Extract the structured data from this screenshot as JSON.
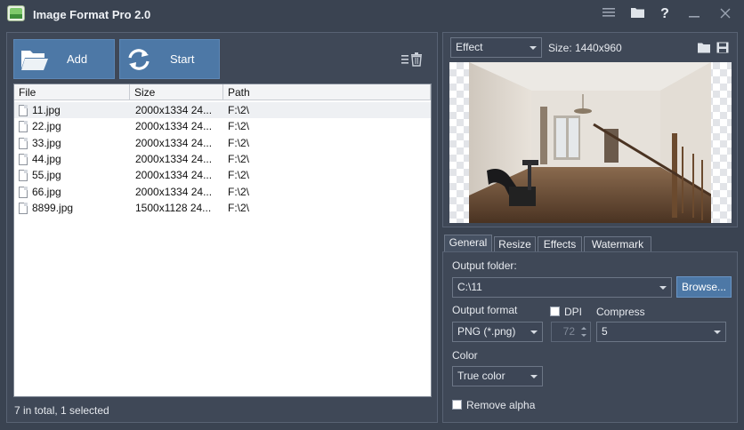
{
  "app": {
    "title": "Image Format Pro 2.0",
    "icons": [
      "menu-icon",
      "folder-icon",
      "help-icon",
      "minimize-icon",
      "close-icon"
    ],
    "help_label": "?"
  },
  "toolbar": {
    "add_label": "Add",
    "start_label": "Start",
    "accent": "#4d78a6"
  },
  "file_list": {
    "columns": [
      "File",
      "Size",
      "Path"
    ],
    "rows": [
      {
        "file": "11.jpg",
        "size": "2000x1334  24...",
        "path": "F:\\2\\",
        "selected": true
      },
      {
        "file": "22.jpg",
        "size": "2000x1334  24...",
        "path": "F:\\2\\"
      },
      {
        "file": "33.jpg",
        "size": "2000x1334  24...",
        "path": "F:\\2\\"
      },
      {
        "file": "44.jpg",
        "size": "2000x1334  24...",
        "path": "F:\\2\\"
      },
      {
        "file": "55.jpg",
        "size": "2000x1334  24...",
        "path": "F:\\2\\"
      },
      {
        "file": "66.jpg",
        "size": "2000x1334  24...",
        "path": "F:\\2\\"
      },
      {
        "file": "8899.jpg",
        "size": "1500x1128  24...",
        "path": "F:\\2\\"
      }
    ],
    "status": "7 in total, 1 selected"
  },
  "preview": {
    "effect_value": "Effect",
    "size_text": "Size: 1440x960"
  },
  "tabs": [
    "General",
    "Resize",
    "Effects",
    "Watermark"
  ],
  "general": {
    "output_folder_label": "Output folder:",
    "output_folder_value": "C:\\11",
    "browse_label": "Browse...",
    "output_format_label": "Output format",
    "output_format_value": "PNG (*.png)",
    "dpi_label": "DPI",
    "dpi_checked": false,
    "dpi_value": "72",
    "compress_label": "Compress",
    "compress_value": "5",
    "color_label": "Color",
    "color_value": "True color",
    "remove_alpha_label": "Remove alpha",
    "remove_alpha_checked": false
  }
}
